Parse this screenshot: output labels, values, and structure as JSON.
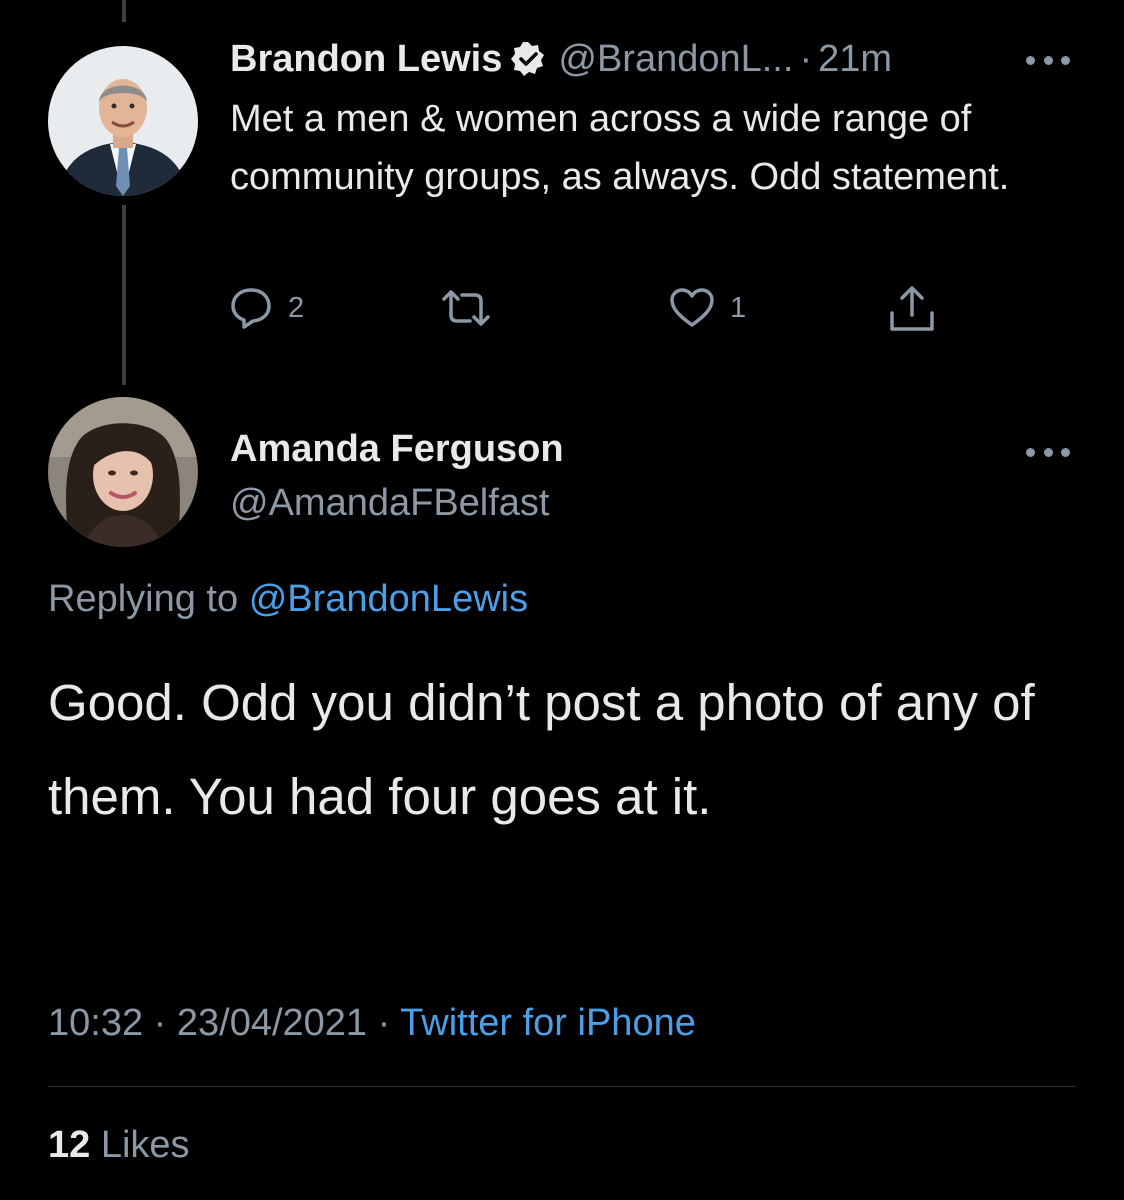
{
  "parent_tweet": {
    "author_name": "Brandon Lewis",
    "handle": "@BrandonL...",
    "separator": "·",
    "time_ago": "21m",
    "text": "Met a men & women across a wide range of community groups, as always. Odd statement.",
    "actions": {
      "reply_count": "2",
      "retweet_count": "",
      "like_count": "1"
    },
    "icons": [
      "verified-badge-icon",
      "reply-icon",
      "retweet-icon",
      "like-icon",
      "share-icon",
      "more-icon"
    ]
  },
  "main_tweet": {
    "author_name": "Amanda Ferguson",
    "handle": "@AmandaFBelfast",
    "replying_prefix": "Replying to",
    "replying_to": "@BrandonLewis",
    "text": "Good. Odd you didn’t post a photo of any of them. You had four goes at it.",
    "time": "10:32",
    "separator": "·",
    "date": "23/04/2021",
    "source": "Twitter for iPhone",
    "likes_count": "12",
    "likes_label": "Likes"
  },
  "colors": {
    "background": "#000000",
    "text_primary": "#e7e9ea",
    "text_secondary": "#8b98a5",
    "link": "#4a9fe6",
    "divider": "#2f3336"
  }
}
